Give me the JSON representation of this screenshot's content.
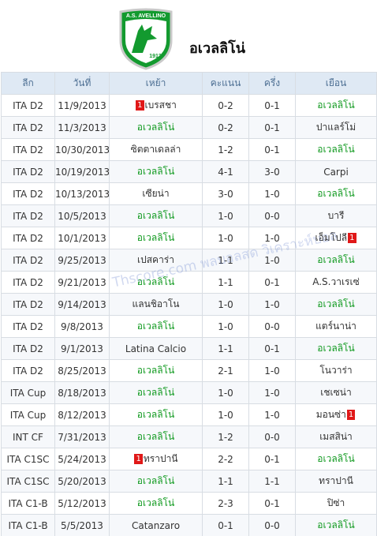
{
  "header": {
    "title": "อเวลลิโน่",
    "logo_text_top": "A.S. AVELLINO",
    "logo_year": "1912"
  },
  "columns": [
    "ลีก",
    "วันที่",
    "เหย้า",
    "คะแนน",
    "ครึ่ง",
    "เยือน"
  ],
  "watermark": "Thscore.com พลบอลสด วิเคราะห์บอล",
  "colors": {
    "highlight_team": "#119a20",
    "score": "#e8001c",
    "badge": "#e01818",
    "header_bg": "#dfe9f4"
  },
  "matches": [
    {
      "league": "ITA D2",
      "date": "11/9/2013",
      "home_badge": "1",
      "home": "เบรสชา",
      "home_hl": false,
      "score": "0-2",
      "half": "0-1",
      "away": "อเวลลิโน่",
      "away_hl": true,
      "away_badge": ""
    },
    {
      "league": "ITA D2",
      "date": "11/3/2013",
      "home_badge": "",
      "home": "อเวลลิโน่",
      "home_hl": true,
      "score": "0-2",
      "half": "0-1",
      "away": "ปาแลร์โม่",
      "away_hl": false,
      "away_badge": ""
    },
    {
      "league": "ITA D2",
      "date": "10/30/2013",
      "home_badge": "",
      "home": "ซิตตาเดลล่า",
      "home_hl": false,
      "score": "1-2",
      "half": "0-1",
      "away": "อเวลลิโน่",
      "away_hl": true,
      "away_badge": ""
    },
    {
      "league": "ITA D2",
      "date": "10/19/2013",
      "home_badge": "",
      "home": "อเวลลิโน่",
      "home_hl": true,
      "score": "4-1",
      "half": "3-0",
      "away": "Carpi",
      "away_hl": false,
      "away_badge": ""
    },
    {
      "league": "ITA D2",
      "date": "10/13/2013",
      "home_badge": "",
      "home": "เซียน่า",
      "home_hl": false,
      "score": "3-0",
      "half": "1-0",
      "away": "อเวลลิโน่",
      "away_hl": true,
      "away_badge": ""
    },
    {
      "league": "ITA D2",
      "date": "10/5/2013",
      "home_badge": "",
      "home": "อเวลลิโน่",
      "home_hl": true,
      "score": "1-0",
      "half": "0-0",
      "away": "บารี",
      "away_hl": false,
      "away_badge": ""
    },
    {
      "league": "ITA D2",
      "date": "10/1/2013",
      "home_badge": "",
      "home": "อเวลลิโน่",
      "home_hl": true,
      "score": "1-0",
      "half": "1-0",
      "away": "เอ็มโปลี",
      "away_hl": false,
      "away_badge": "1"
    },
    {
      "league": "ITA D2",
      "date": "9/25/2013",
      "home_badge": "",
      "home": "เปสคาร่า",
      "home_hl": false,
      "score": "1-1",
      "half": "1-0",
      "away": "อเวลลิโน่",
      "away_hl": true,
      "away_badge": ""
    },
    {
      "league": "ITA D2",
      "date": "9/21/2013",
      "home_badge": "",
      "home": "อเวลลิโน่",
      "home_hl": true,
      "score": "1-1",
      "half": "0-1",
      "away": "A.S.วาเรเซ่",
      "away_hl": false,
      "away_badge": ""
    },
    {
      "league": "ITA D2",
      "date": "9/14/2013",
      "home_badge": "",
      "home": "แลนชิอาโน",
      "home_hl": false,
      "score": "1-0",
      "half": "1-0",
      "away": "อเวลลิโน่",
      "away_hl": true,
      "away_badge": ""
    },
    {
      "league": "ITA D2",
      "date": "9/8/2013",
      "home_badge": "",
      "home": "อเวลลิโน่",
      "home_hl": true,
      "score": "1-0",
      "half": "0-0",
      "away": "แตร์นาน่า",
      "away_hl": false,
      "away_badge": ""
    },
    {
      "league": "ITA D2",
      "date": "9/1/2013",
      "home_badge": "",
      "home": "Latina Calcio",
      "home_hl": false,
      "score": "1-1",
      "half": "0-1",
      "away": "อเวลลิโน่",
      "away_hl": true,
      "away_badge": ""
    },
    {
      "league": "ITA D2",
      "date": "8/25/2013",
      "home_badge": "",
      "home": "อเวลลิโน่",
      "home_hl": true,
      "score": "2-1",
      "half": "1-0",
      "away": "โนวาร่า",
      "away_hl": false,
      "away_badge": ""
    },
    {
      "league": "ITA Cup",
      "date": "8/18/2013",
      "home_badge": "",
      "home": "อเวลลิโน่",
      "home_hl": true,
      "score": "1-0",
      "half": "1-0",
      "away": "เชเซน่า",
      "away_hl": false,
      "away_badge": ""
    },
    {
      "league": "ITA Cup",
      "date": "8/12/2013",
      "home_badge": "",
      "home": "อเวลลิโน่",
      "home_hl": true,
      "score": "1-0",
      "half": "1-0",
      "away": "มอนซ่า",
      "away_hl": false,
      "away_badge": "1"
    },
    {
      "league": "INT CF",
      "date": "7/31/2013",
      "home_badge": "",
      "home": "อเวลลิโน่",
      "home_hl": true,
      "score": "1-2",
      "half": "0-0",
      "away": "เมสสิน่า",
      "away_hl": false,
      "away_badge": ""
    },
    {
      "league": "ITA C1SC",
      "date": "5/24/2013",
      "home_badge": "1",
      "home": "ทราปานี",
      "home_hl": false,
      "score": "2-2",
      "half": "0-1",
      "away": "อเวลลิโน่",
      "away_hl": true,
      "away_badge": ""
    },
    {
      "league": "ITA C1SC",
      "date": "5/20/2013",
      "home_badge": "",
      "home": "อเวลลิโน่",
      "home_hl": true,
      "score": "1-1",
      "half": "1-1",
      "away": "ทราปานี",
      "away_hl": false,
      "away_badge": ""
    },
    {
      "league": "ITA C1-B",
      "date": "5/12/2013",
      "home_badge": "",
      "home": "อเวลลิโน่",
      "home_hl": true,
      "score": "2-3",
      "half": "0-1",
      "away": "ปิซ่า",
      "away_hl": false,
      "away_badge": ""
    },
    {
      "league": "ITA C1-B",
      "date": "5/5/2013",
      "home_badge": "",
      "home": "Catanzaro",
      "home_hl": false,
      "score": "0-1",
      "half": "0-0",
      "away": "อเวลลิโน่",
      "away_hl": true,
      "away_badge": ""
    }
  ]
}
